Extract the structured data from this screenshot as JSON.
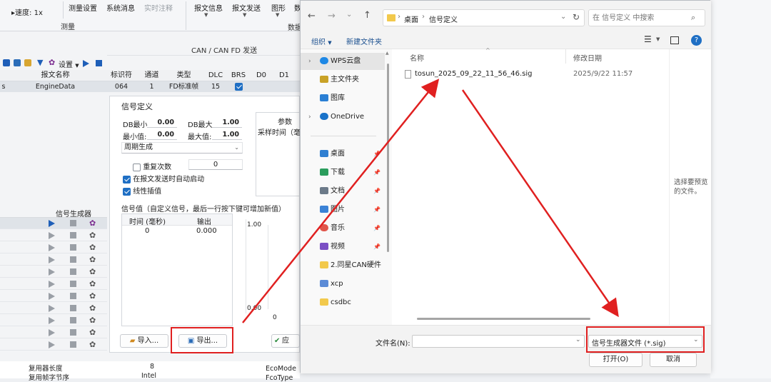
{
  "ribbon": {
    "speed_label": "速度: 1x",
    "group1": "测量",
    "group2": "数据",
    "items": [
      "测量设置",
      "系统消息",
      "实时注释",
      "报文信息",
      "报文发送",
      "图形",
      "数"
    ],
    "disabled_items": [
      "实时注释"
    ]
  },
  "app": {
    "window_title": "CAN / CAN FD 发送",
    "toolbar_settings": "设置",
    "grid_headers": [
      "报文名称",
      "标识符",
      "通道",
      "类型",
      "DLC",
      "BRS",
      "D0",
      "D1"
    ],
    "grid_row": {
      "prefix": "s",
      "name": "EngineData",
      "id": "064",
      "channel": "1",
      "type": "FD标准帧",
      "dlc": "15",
      "brs": true
    },
    "signal_def_title": "信号定义",
    "db_min_label": "DB最小:",
    "db_min": "0.00",
    "db_max_label": "DB最大:",
    "db_max": "1.00",
    "min_label": "最小值:",
    "min": "0.00",
    "max_label": "最大值:",
    "max": "1.00",
    "mode": "周期生成",
    "repeat_label": "重复次数",
    "repeat_value": "0",
    "auto_start_label": "在报文发送时自动启动",
    "linear_label": "线性插值",
    "params_title": "参数",
    "sample_time_label": "采样时间（毫",
    "signal_values_title": "信号值（自定义信号，最后一行按下键可增加新值）",
    "table_headers": [
      "时间 (毫秒)",
      "输出"
    ],
    "table_rows": [
      [
        "0",
        "0.000"
      ]
    ],
    "chart_ymax": "1.00",
    "chart_ymin": "0.00",
    "chart_x0": "0",
    "import_label": "导入...",
    "export_label": "导出...",
    "apply_label": "应",
    "signal_gen_header": "信号生成器",
    "bottom_row1_label": "复用器长度",
    "bottom_row1_value": "8",
    "bottom_row2_label": "复用帧字节序",
    "bottom_row2_value": "Intel",
    "bottom_items": [
      "EcoMode",
      "FcoType"
    ]
  },
  "dialog": {
    "breadcrumb": [
      "桌面",
      "信号定义"
    ],
    "search_placeholder": "在 信号定义 中搜索",
    "organize_label": "组织",
    "new_folder_label": "新建文件夹",
    "nav_items": [
      {
        "label": "WPS云盘",
        "icon": "cloud-icon",
        "color": "#1e88e5"
      },
      {
        "label": "主文件夹",
        "icon": "home-icon",
        "color": "#c9a227"
      },
      {
        "label": "图库",
        "icon": "gallery-icon",
        "color": "#2a7fd4"
      },
      {
        "label": "OneDrive",
        "icon": "onedrive-icon",
        "color": "#1a73c9"
      },
      {
        "label": "桌面",
        "icon": "desktop-icon",
        "color": "#2f7fd1"
      },
      {
        "label": "下载",
        "icon": "download-icon",
        "color": "#2a9d5c"
      },
      {
        "label": "文档",
        "icon": "document-icon",
        "color": "#6c7a89"
      },
      {
        "label": "图片",
        "icon": "pictures-icon",
        "color": "#3b82d6"
      },
      {
        "label": "音乐",
        "icon": "music-icon",
        "color": "#e0554a"
      },
      {
        "label": "视频",
        "icon": "video-icon",
        "color": "#7b4fc4"
      },
      {
        "label": "2.同星CAN硬件",
        "icon": "folder-icon",
        "color": "#f2c94c"
      },
      {
        "label": "xcp",
        "icon": "xcp-icon",
        "color": "#5b8bd6"
      },
      {
        "label": "csdbc",
        "icon": "folder-icon",
        "color": "#f2c94c"
      }
    ],
    "column_name": "名称",
    "column_modified": "修改日期",
    "files": [
      {
        "name": "tosun_2025_09_22_11_56_46.sig",
        "modified": "2025/9/22 11:57"
      }
    ],
    "preview_text": "选择要预览的文件。",
    "filename_label": "文件名(N):",
    "filename_value": "",
    "filetype": "信号生成器文件 (*.sig)",
    "open_label": "打开(O)",
    "cancel_label": "取消"
  },
  "colors": {
    "annotation_red": "#e02020",
    "accent_blue": "#1f6fc4"
  }
}
